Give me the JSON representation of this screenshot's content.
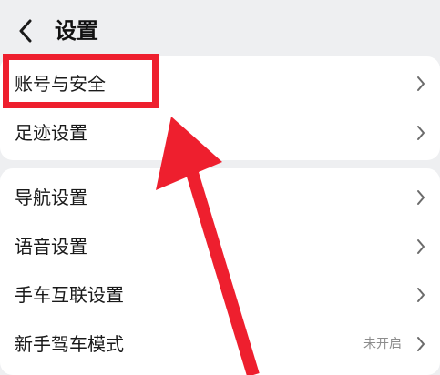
{
  "header": {
    "title": "设置",
    "back_icon": "chevron-left-icon"
  },
  "groups": [
    {
      "items": [
        {
          "label": "账号与安全",
          "icon": "chevron-right-icon"
        },
        {
          "label": "足迹设置",
          "icon": "chevron-right-icon"
        }
      ]
    },
    {
      "items": [
        {
          "label": "导航设置",
          "icon": "chevron-right-icon"
        },
        {
          "label": "语音设置",
          "icon": "chevron-right-icon"
        },
        {
          "label": "手车互联设置",
          "icon": "chevron-right-icon"
        },
        {
          "label": "新手驾车模式",
          "status": "未开启",
          "icon": "chevron-right-icon"
        }
      ]
    }
  ],
  "annotation": {
    "color": "#ee1f2e",
    "target": "账号与安全"
  },
  "colors": {
    "background": "#eeeff1",
    "card": "#ffffff",
    "text": "#1a1a1a",
    "muted": "#8c8c8c"
  }
}
